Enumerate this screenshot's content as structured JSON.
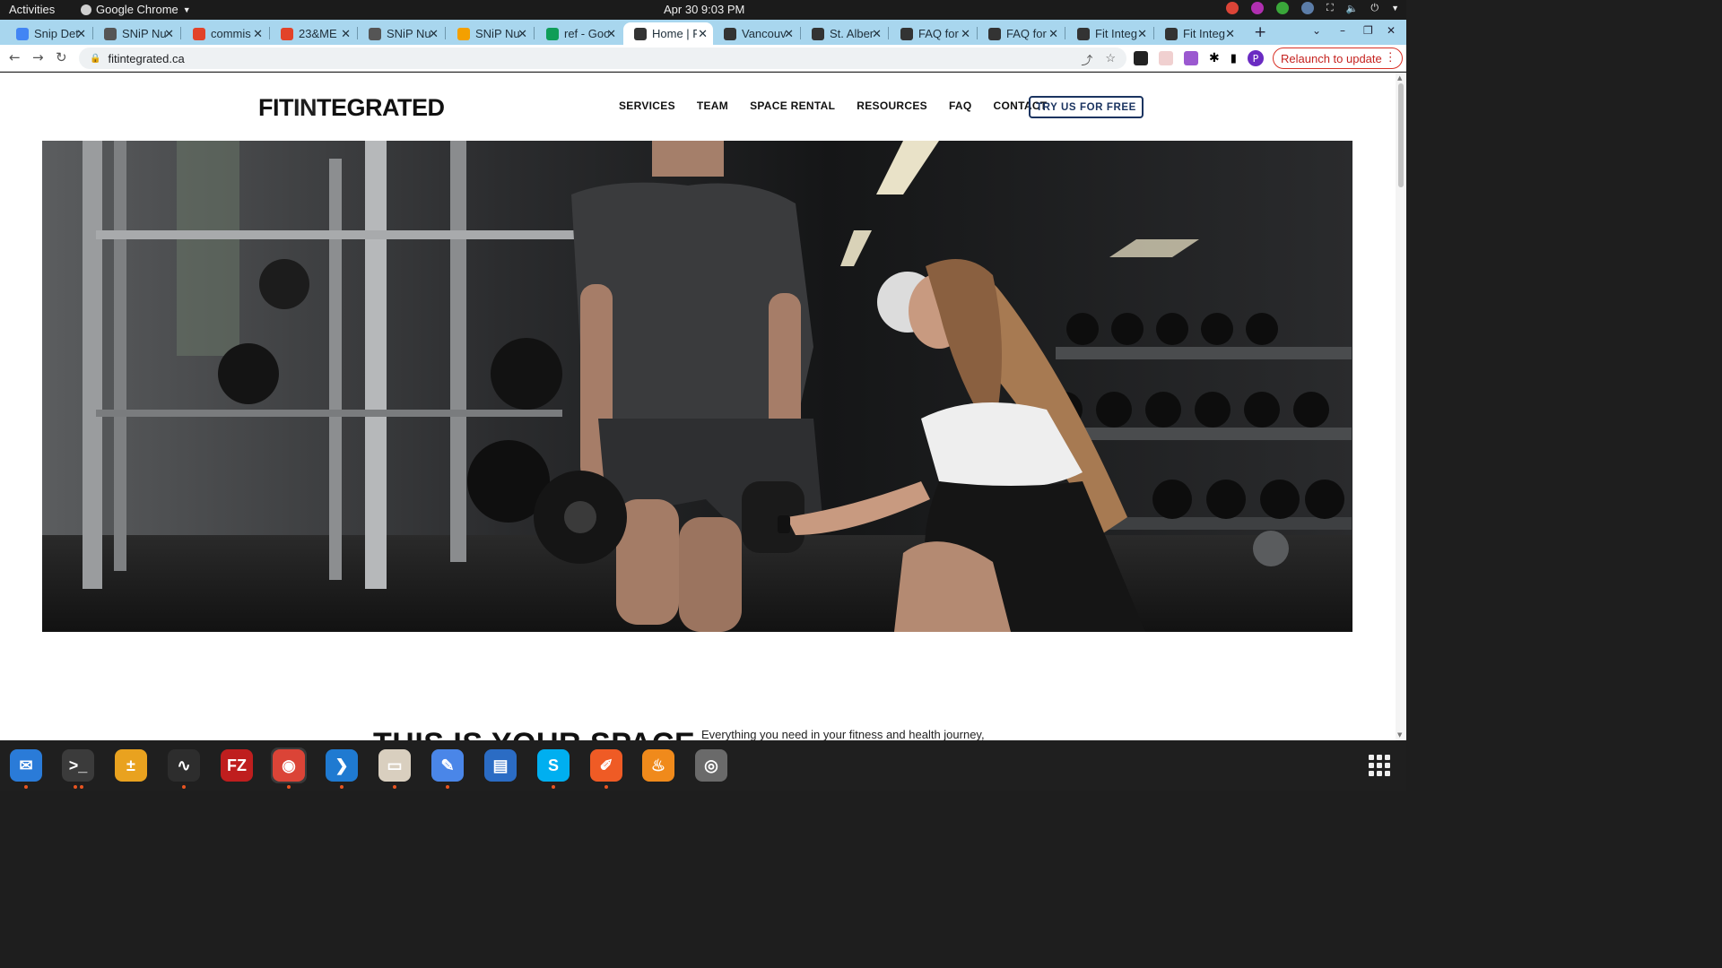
{
  "system": {
    "activities": "Activities",
    "app_name": "Google Chrome",
    "clock": "Apr 30  9:03 PM"
  },
  "tabs": [
    {
      "title": "Snip Det",
      "icon": "docs-icon",
      "color": "#4285f4"
    },
    {
      "title": "SNiP Nu",
      "icon": "snip-favicon",
      "color": "#555555"
    },
    {
      "title": "commis",
      "icon": "gitlab-icon",
      "color": "#e24329"
    },
    {
      "title": "23&ME",
      "icon": "gitlab-icon",
      "color": "#e24329"
    },
    {
      "title": "SNiP Nu",
      "icon": "snip-favicon",
      "color": "#555555"
    },
    {
      "title": "SNiP Nu",
      "icon": "snip-favicon",
      "color": "#f4a000"
    },
    {
      "title": "ref - Goo",
      "icon": "sheets-icon",
      "color": "#0f9d58"
    },
    {
      "title": "Home | F",
      "icon": "fit-favicon",
      "color": "#333333",
      "active": true
    },
    {
      "title": "Vancouv",
      "icon": "fit-favicon",
      "color": "#333333"
    },
    {
      "title": "St. Alber",
      "icon": "fit-favicon",
      "color": "#333333"
    },
    {
      "title": "FAQ for",
      "icon": "fit-favicon",
      "color": "#333333"
    },
    {
      "title": "FAQ for",
      "icon": "fit-favicon",
      "color": "#333333"
    },
    {
      "title": "Fit Integ",
      "icon": "fit-favicon",
      "color": "#333333"
    },
    {
      "title": "Fit Integ",
      "icon": "fit-favicon",
      "color": "#333333"
    }
  ],
  "toolbar": {
    "url": "fitintegrated.ca",
    "relaunch_label": "Relaunch to update",
    "profile_initial": "P"
  },
  "site": {
    "logo_a": "FIT",
    "logo_b": "IN",
    "logo_c": "TEGRATED",
    "nav": [
      "SERVICES",
      "TEAM",
      "SPACE RENTAL",
      "RESOURCES",
      "FAQ",
      "CONTACT"
    ],
    "cta_label": "TRY US FOR FREE",
    "headline": "THIS IS YOUR SPACE",
    "tagline": "Everything you need in your fitness and health journey,"
  },
  "dock": [
    {
      "name": "thunderbird-icon",
      "color": "#2a7bd8",
      "glyph": "✉",
      "dots": 1
    },
    {
      "name": "terminal-icon",
      "color": "#3b3b3b",
      "glyph": ">_",
      "dots": 2
    },
    {
      "name": "calculator-icon",
      "color": "#e9a21f",
      "glyph": "±",
      "dots": 0
    },
    {
      "name": "system-monitor-icon",
      "color": "#2d2d2d",
      "glyph": "∿",
      "dots": 1
    },
    {
      "name": "filezilla-icon",
      "color": "#bf1e1e",
      "glyph": "FZ",
      "dots": 0
    },
    {
      "name": "chrome-icon",
      "color": "#db4437",
      "glyph": "◉",
      "dots": 1,
      "running": true
    },
    {
      "name": "vscode-icon",
      "color": "#1f7ad1",
      "glyph": "❯",
      "dots": 1
    },
    {
      "name": "files-icon",
      "color": "#d9cfbf",
      "glyph": "▭",
      "dots": 1
    },
    {
      "name": "text-editor-icon",
      "color": "#4a86e8",
      "glyph": "✎",
      "dots": 1
    },
    {
      "name": "document-viewer-icon",
      "color": "#2b6cc4",
      "glyph": "▤",
      "dots": 0
    },
    {
      "name": "skype-icon",
      "color": "#00aff0",
      "glyph": "S",
      "dots": 1
    },
    {
      "name": "postman-icon",
      "color": "#ef5b25",
      "glyph": "✐",
      "dots": 1
    },
    {
      "name": "blaze-icon",
      "color": "#f08a1b",
      "glyph": "♨",
      "dots": 0
    },
    {
      "name": "disk-icon",
      "color": "#6a6a6a",
      "glyph": "◎",
      "dots": 0
    }
  ]
}
